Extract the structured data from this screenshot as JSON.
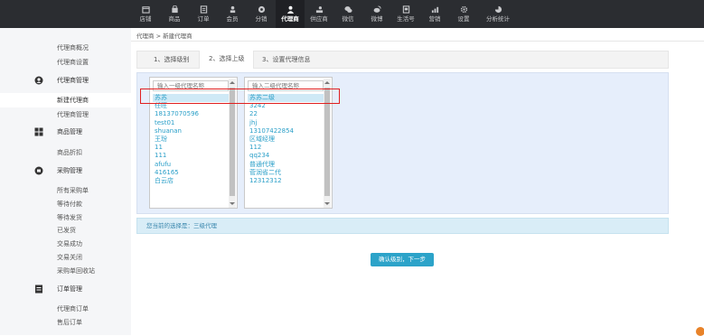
{
  "nav": [
    {
      "label": "店铺",
      "icon": "store-icon"
    },
    {
      "label": "商品",
      "icon": "bag-icon"
    },
    {
      "label": "订单",
      "icon": "list-icon"
    },
    {
      "label": "会员",
      "icon": "member-icon"
    },
    {
      "label": "分销",
      "icon": "distribute-icon"
    },
    {
      "label": "代理商",
      "icon": "agent-icon",
      "active": true
    },
    {
      "label": "供应商",
      "icon": "supplier-icon"
    },
    {
      "label": "微信",
      "icon": "wechat-icon"
    },
    {
      "label": "微博",
      "icon": "weibo-icon"
    },
    {
      "label": "生活号",
      "icon": "life-icon"
    },
    {
      "label": "营销",
      "icon": "marketing-icon"
    },
    {
      "label": "设置",
      "icon": "gear-icon"
    },
    {
      "label": "分析统计",
      "icon": "stats-icon"
    }
  ],
  "sidebar": {
    "top_links": [
      "代理商概况",
      "代理商设置"
    ],
    "groups": [
      {
        "title": "代理商管理",
        "icon": "user-icon",
        "links": [
          "新建代理商",
          "代理商管理"
        ]
      },
      {
        "title": "商品管理",
        "icon": "grid-icon",
        "links": [
          "商品折扣"
        ]
      },
      {
        "title": "采购管理",
        "icon": "cart-icon",
        "links": [
          "所有采购单",
          "等待付款",
          "等待发货",
          "已发货",
          "交易成功",
          "交易关闭",
          "采购单回收站"
        ]
      },
      {
        "title": "订单管理",
        "icon": "doc-icon",
        "links": [
          "代理商订单",
          "售后订单"
        ]
      }
    ]
  },
  "breadcrumb": "代理商 > 新建代理商",
  "tabs": [
    "1、选择级别",
    "2、选择上级",
    "3、设置代理信息"
  ],
  "list1": {
    "placeholder": "输入一级代理名称",
    "items": [
      "苏苏",
      "任旺",
      "18137070596",
      "test01",
      "shuanan",
      "王玢",
      "11",
      "111",
      "afufu",
      "416165",
      "白云店"
    ]
  },
  "list2": {
    "placeholder": "输入二级代理名称",
    "items": [
      "苏苏二级",
      "3242",
      "22",
      "jhj",
      "13107422854",
      "区域经理",
      "112",
      "qq234",
      "普通代理",
      "菅润省二代",
      "12312312"
    ]
  },
  "choice_text": "您当前的选择是：三级代理",
  "confirm_label": "确认级别，下一步"
}
